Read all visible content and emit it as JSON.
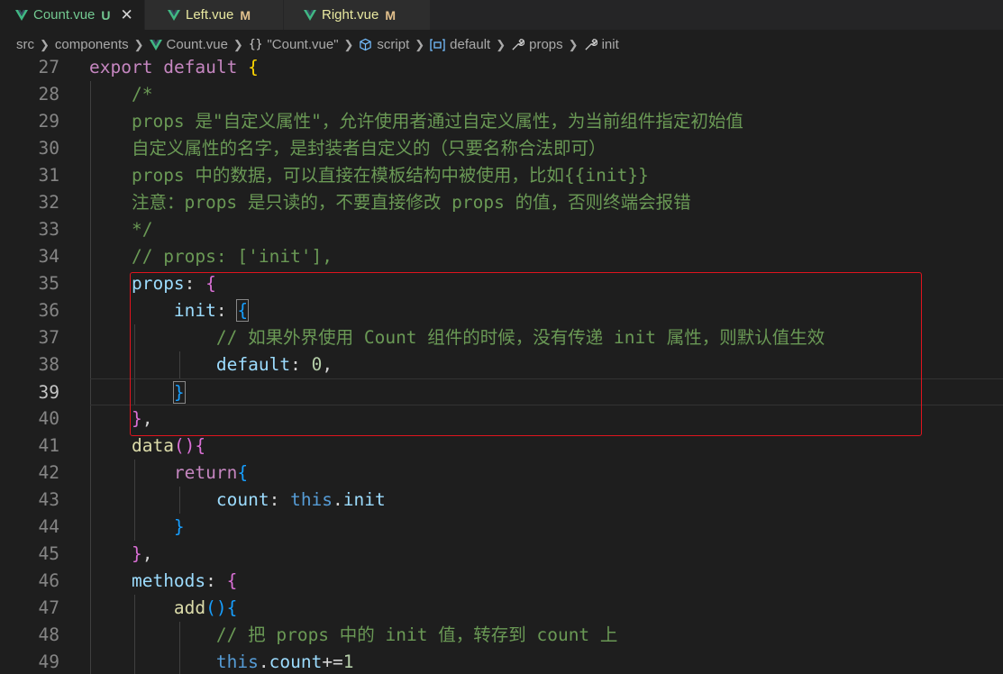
{
  "tabs": [
    {
      "name": "Count.vue",
      "status": "U",
      "active": true,
      "close": "✕"
    },
    {
      "name": "Left.vue",
      "status": "M",
      "active": false
    },
    {
      "name": "Right.vue",
      "status": "M",
      "active": false
    }
  ],
  "breadcrumb": {
    "src": "src",
    "components": "components",
    "file": "Count.vue",
    "braces": "{}",
    "object": "\"Count.vue\"",
    "script": "script",
    "default": "default",
    "props": "props",
    "init": "init"
  },
  "editor": {
    "active_line": "39",
    "line_numbers": [
      "27",
      "28",
      "29",
      "30",
      "31",
      "32",
      "33",
      "34",
      "35",
      "36",
      "37",
      "38",
      "39",
      "40",
      "41",
      "42",
      "43",
      "44",
      "45",
      "46",
      "47",
      "48",
      "49"
    ],
    "code": {
      "l27_export": "export",
      "l27_default": "default",
      "l27_brace": "{",
      "l28": "/*",
      "l29": "props 是\"自定义属性\"，允许使用者通过自定义属性，为当前组件指定初始值",
      "l30": "自定义属性的名字，是封装者自定义的（只要名称合法即可）",
      "l31": "props 中的数据，可以直接在模板结构中被使用，比如{{init}}",
      "l32": "注意：props 是只读的，不要直接修改 props 的值，否则终端会报错",
      "l33": "*/",
      "l34": "// props: ['init'],",
      "l35_key": "props",
      "l35_colon": ": ",
      "l35_brace": "{",
      "l36_key": "init",
      "l36_colon": ": ",
      "l36_brace": "{",
      "l37": "// 如果外界使用 Count 组件的时候，没有传递 init 属性，则默认值生效",
      "l38_key": "default",
      "l38_colon": ": ",
      "l38_num": "0",
      "l38_comma": ",",
      "l39_brace": "}",
      "l40_brace": "}",
      "l40_comma": ",",
      "l41_fn": "data",
      "l41_paren": "()",
      "l41_brace": "{",
      "l42_kw": "return",
      "l42_brace": "{",
      "l43_key": "count",
      "l43_colon": ": ",
      "l43_this": "this",
      "l43_dot": ".",
      "l43_prop": "init",
      "l44_brace": "}",
      "l45_brace": "}",
      "l45_comma": ",",
      "l46_key": "methods",
      "l46_colon": ": ",
      "l46_brace": "{",
      "l47_fn": "add",
      "l47_paren": "()",
      "l47_brace": "{",
      "l48": "// 把 props 中的 init 值，转存到 count 上",
      "l49_this": "this",
      "l49_dot": ".",
      "l49_prop": "count",
      "l49_op": "+=",
      "l49_num": "1"
    }
  },
  "colors": {
    "background": "#1e1e1e",
    "keyword": "#c586c0",
    "comment": "#6a9955",
    "property": "#9cdcfe",
    "function": "#dcdcaa",
    "annotation_box": "#e0141e",
    "vue_green": "#41b883"
  },
  "icons": [
    "vue-file-icon",
    "close-icon",
    "chevron-right-icon",
    "braces-icon",
    "cube-icon",
    "variable-icon",
    "wrench-icon"
  ]
}
